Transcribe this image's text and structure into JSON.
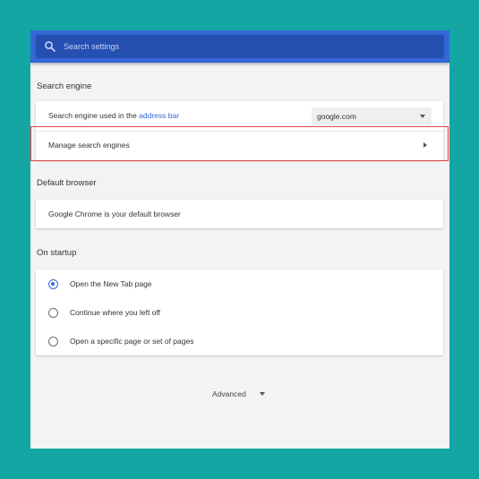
{
  "search": {
    "placeholder": "Search settings"
  },
  "search_engine": {
    "title": "Search engine",
    "used_in_label": "Search engine used in the ",
    "address_bar_link": "address bar",
    "selected": "google.com",
    "manage_label": "Manage search engines"
  },
  "default_browser": {
    "title": "Default browser",
    "status": "Google Chrome is your default browser"
  },
  "on_startup": {
    "title": "On startup",
    "options": [
      {
        "label": "Open the New Tab page",
        "checked": true
      },
      {
        "label": "Continue where you left off",
        "checked": false
      },
      {
        "label": "Open a specific page or set of pages",
        "checked": false
      }
    ]
  },
  "advanced": {
    "label": "Advanced"
  },
  "colors": {
    "background": "#14a6a3",
    "header": "#3367d6",
    "search_field": "#254fb0",
    "accent": "#3367d6",
    "highlight_border": "#e04545"
  },
  "icons": {
    "search": "search-icon",
    "dropdown": "chevron-down-icon",
    "manage_arrow": "arrow-right-icon",
    "advanced": "caret-down-icon"
  }
}
